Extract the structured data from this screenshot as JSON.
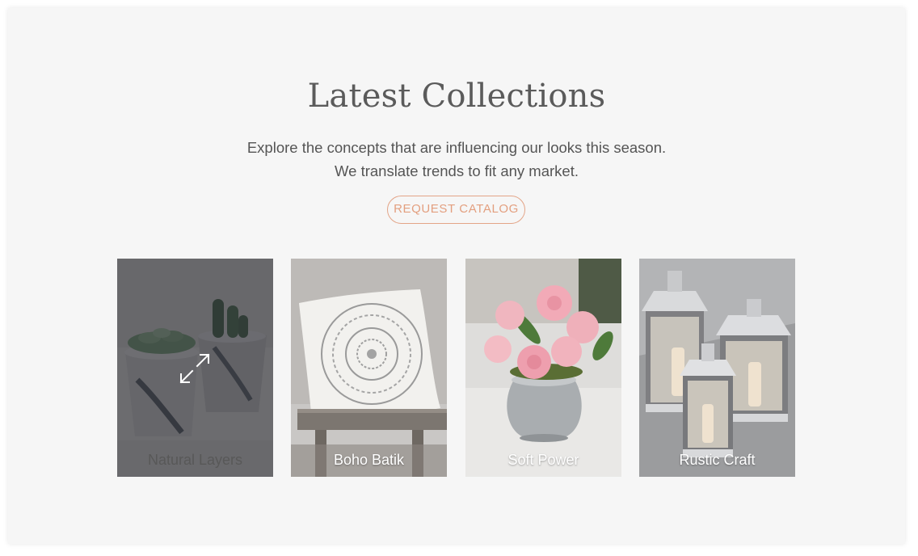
{
  "header": {
    "title": "Latest Collections",
    "subtitle_line1": "Explore the concepts that are influencing our looks this season.",
    "subtitle_line2": "We translate trends to fit any market.",
    "cta_label": "REQUEST CATALOG"
  },
  "collections": [
    {
      "label": "Natural Layers",
      "state": "hovered",
      "icon": "expand-icon"
    },
    {
      "label": "Boho Batik"
    },
    {
      "label": "Soft Power"
    },
    {
      "label": "Rustic Craft"
    }
  ],
  "colors": {
    "background": "#f6f6f6",
    "title": "#5b5b5b",
    "text": "#555555",
    "accent": "#e3a487"
  }
}
